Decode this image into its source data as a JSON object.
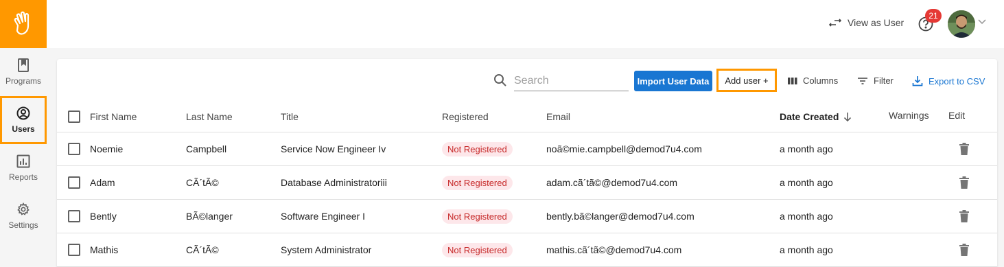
{
  "nav": {
    "items": [
      {
        "label": "Programs",
        "icon": "book-icon"
      },
      {
        "label": "Users",
        "icon": "user-circle-icon",
        "active": true
      },
      {
        "label": "Reports",
        "icon": "bar-chart-icon"
      },
      {
        "label": "Settings",
        "icon": "gear-icon"
      }
    ]
  },
  "topbar": {
    "view_as_label": "View as User",
    "notification_count": "21"
  },
  "toolbar": {
    "search_placeholder": "Search",
    "import_label": "Import User Data",
    "add_user_label": "Add user +",
    "columns_label": "Columns",
    "filter_label": "Filter",
    "export_label": "Export to CSV"
  },
  "table": {
    "headers": {
      "first_name": "First Name",
      "last_name": "Last Name",
      "title": "Title",
      "registered": "Registered",
      "email": "Email",
      "date_created": "Date Created",
      "warnings": "Warnings",
      "edit": "Edit"
    },
    "rows": [
      {
        "first": "Noemie",
        "last": "Campbell",
        "title": "Service Now Engineer Iv",
        "registered": "Not Registered",
        "email": "noã©mie.campbell@demod7u4.com",
        "created": "a month ago"
      },
      {
        "first": "Adam",
        "last": "CÃ´tÃ©",
        "title": "Database Administratoriii",
        "registered": "Not Registered",
        "email": "adam.cã´tã©@demod7u4.com",
        "created": "a month ago"
      },
      {
        "first": "Bently",
        "last": "BÃ©langer",
        "title": "Software Engineer I",
        "registered": "Not Registered",
        "email": "bently.bã©langer@demod7u4.com",
        "created": "a month ago"
      },
      {
        "first": "Mathis",
        "last": "CÃ´tÃ©",
        "title": "System Administrator",
        "registered": "Not Registered",
        "email": "mathis.cã´tã©@demod7u4.com",
        "created": "a month ago"
      }
    ]
  },
  "colors": {
    "brand": "#ff9800",
    "primary": "#1976d2",
    "danger": "#e53935"
  }
}
